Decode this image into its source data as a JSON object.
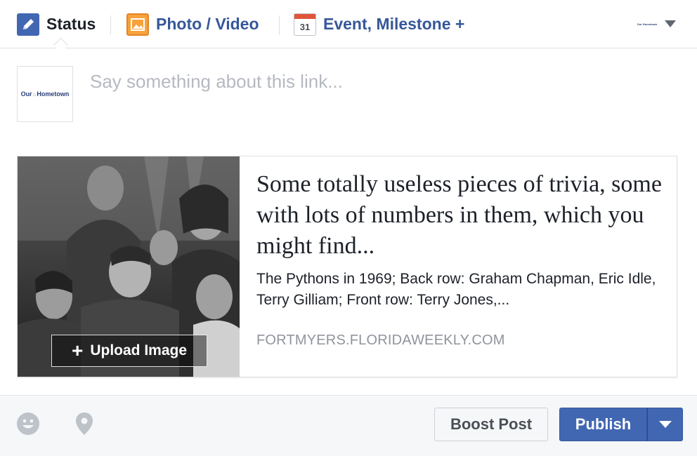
{
  "tabs": [
    {
      "label": "Status",
      "icon": "pencil-icon",
      "active": true
    },
    {
      "label": "Photo / Video",
      "icon": "photo-icon",
      "active": false
    },
    {
      "label": "Event, Milestone +",
      "icon": "calendar-icon",
      "active": false
    }
  ],
  "calendar_icon_text": "31",
  "page_selector": {
    "logo_text": "Our Hometown"
  },
  "composer": {
    "placeholder": "Say something about this link...",
    "avatar_text_left": "Our",
    "avatar_text_right": "Hometown"
  },
  "link_preview": {
    "title": "Some totally useless pieces of trivia, some with lots of numbers in them, which you might find...",
    "description": "The Pythons in 1969; Back row: Graham Chapman, Eric Idle, Terry Gilliam; Front row: Terry Jones,...",
    "domain": "FORTMYERS.FLORIDAWEEKLY.COM",
    "upload_label": "Upload Image"
  },
  "footer": {
    "boost_label": "Boost Post",
    "publish_label": "Publish"
  },
  "colors": {
    "brand_blue": "#4267b2",
    "link_blue": "#365899",
    "placeholder_gray": "#b5b9c0",
    "domain_gray": "#90949c"
  }
}
